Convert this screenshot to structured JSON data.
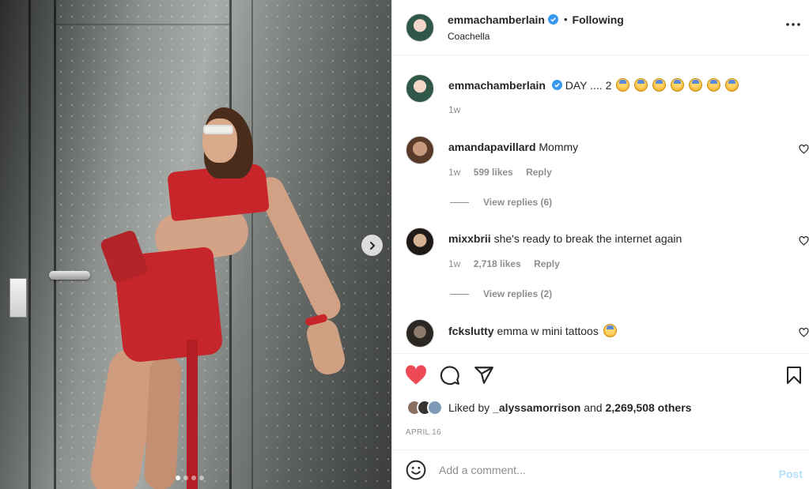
{
  "post": {
    "author": "emmachamberlain",
    "follow_status": "Following",
    "separator": "•",
    "location": "Coachella",
    "more_icon": "more-horizontal-icon",
    "verified_color": "#3897f0"
  },
  "photo": {
    "carousel_count": 4,
    "carousel_active": 1,
    "next_icon": "chevron-right-icon"
  },
  "caption": {
    "username": "emmachamberlain",
    "text": "DAY .... 2",
    "emoji_count": 7,
    "time": "1w"
  },
  "comments": [
    {
      "username": "amandapavillard",
      "text": "Mommy",
      "time": "1w",
      "likes": "599 likes",
      "reply": "Reply",
      "view_replies": "View replies (6)"
    },
    {
      "username": "mixxbrii",
      "text": "she's ready to break the internet again",
      "time": "1w",
      "likes": "2,718 likes",
      "reply": "Reply",
      "view_replies": "View replies (2)"
    },
    {
      "username": "fckslutty",
      "text": "emma w mini tattoos"
    }
  ],
  "actions": {
    "like_icon": "heart-filled-icon",
    "comment_icon": "comment-icon",
    "share_icon": "send-icon",
    "save_icon": "bookmark-icon",
    "like_color": "#ed4956"
  },
  "likes": {
    "prefix": "Liked by",
    "user": "_alyssamorrison",
    "conj": "and",
    "others": "2,269,508 others"
  },
  "date": "APRIL 16",
  "add_comment": {
    "placeholder": "Add a comment...",
    "post_label": "Post",
    "emoji_icon": "smiley-icon"
  }
}
